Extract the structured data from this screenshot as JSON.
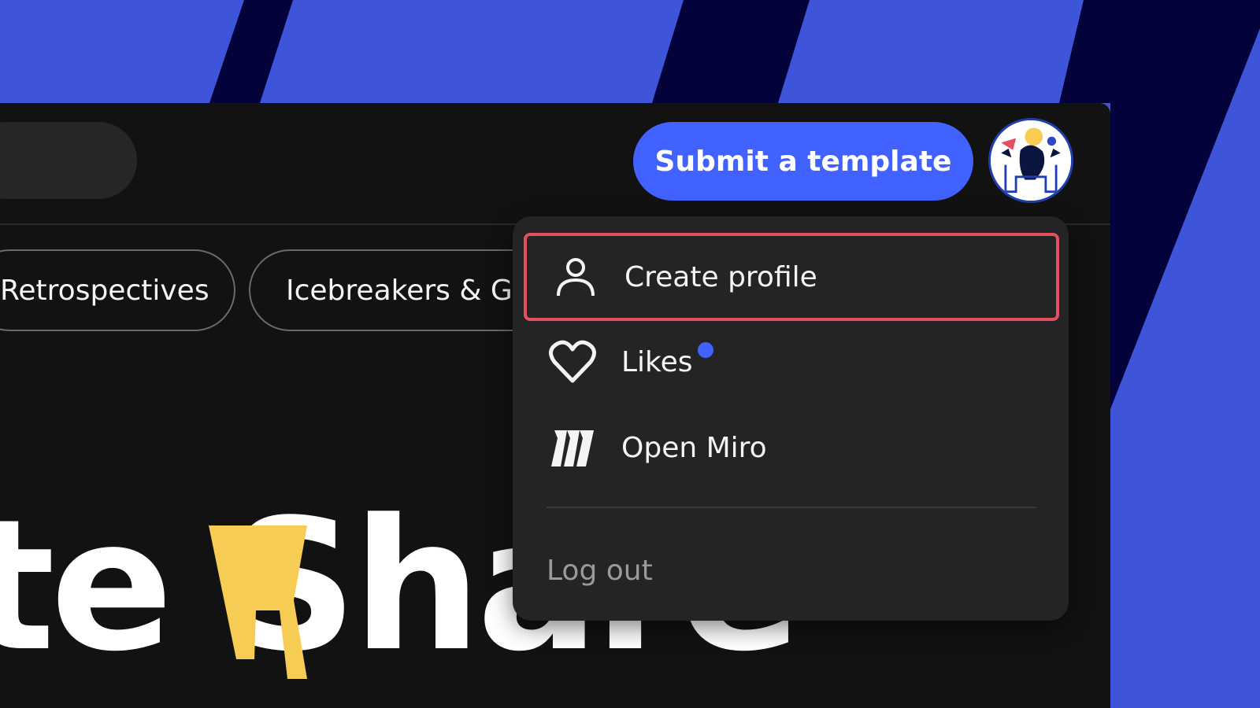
{
  "header": {
    "submit_label": "Submit a template",
    "avatar_icon": "user-avatar-illustration"
  },
  "categories": [
    {
      "label": "Retrospectives"
    },
    {
      "label": "Icebreakers & G"
    }
  ],
  "hero": {
    "text": "te  Share",
    "mark_icon": "yellow-mark-logo"
  },
  "profile_menu": {
    "items": [
      {
        "label": "Create profile",
        "icon": "person-icon",
        "highlighted": true
      },
      {
        "label": "Likes",
        "icon": "heart-icon",
        "has_notification_dot": true
      },
      {
        "label": "Open Miro",
        "icon": "miro-logo-icon"
      }
    ],
    "logout_label": "Log out"
  },
  "colors": {
    "background_blue": "#3f55d9",
    "stripe_navy": "#04023a",
    "panel": "#121212",
    "menu": "#242424",
    "accent_blue": "#4262ff",
    "highlight_red": "#e5505e",
    "hero_yellow": "#f7cc55"
  }
}
